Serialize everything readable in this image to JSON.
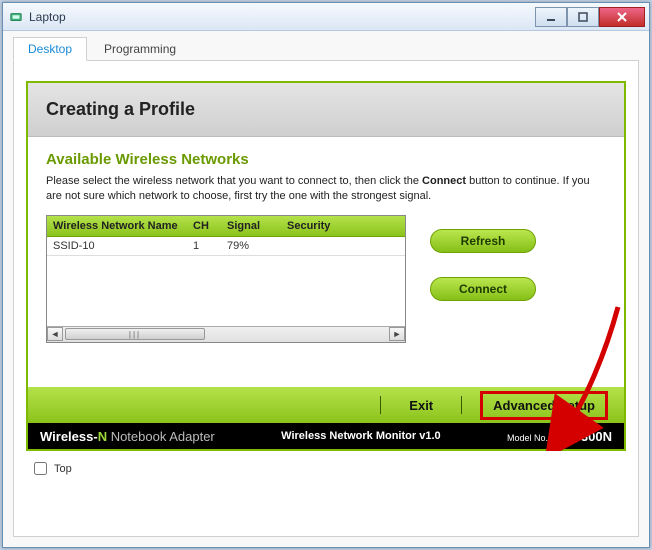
{
  "window": {
    "title": "Laptop"
  },
  "tabs": {
    "desktop": "Desktop",
    "programming": "Programming"
  },
  "widget": {
    "header": "Creating a Profile",
    "subhead": "Available Wireless Networks",
    "instruction_pre": "Please select the wireless network that you want to connect to, then click the ",
    "instruction_bold": "Connect",
    "instruction_post": " button to continue. If you are not sure which network to choose, first try the one with the strongest signal."
  },
  "table": {
    "headers": {
      "name": "Wireless Network Name",
      "ch": "CH",
      "signal": "Signal",
      "security": "Security"
    },
    "rows": [
      {
        "name": "SSID-10",
        "ch": "1",
        "signal": "79%",
        "security": ""
      }
    ]
  },
  "buttons": {
    "refresh": "Refresh",
    "connect": "Connect",
    "exit": "Exit",
    "advanced": "Advanced  Setup"
  },
  "footer": {
    "brand_bold": "Wireless-",
    "brand_n": "N",
    "brand_rest": " Notebook Adapter",
    "mid": "Wireless Network Monitor  v1.0",
    "model_label": "Model No.",
    "model_value": "WPC300N"
  },
  "bottom": {
    "top_label": "Top"
  }
}
